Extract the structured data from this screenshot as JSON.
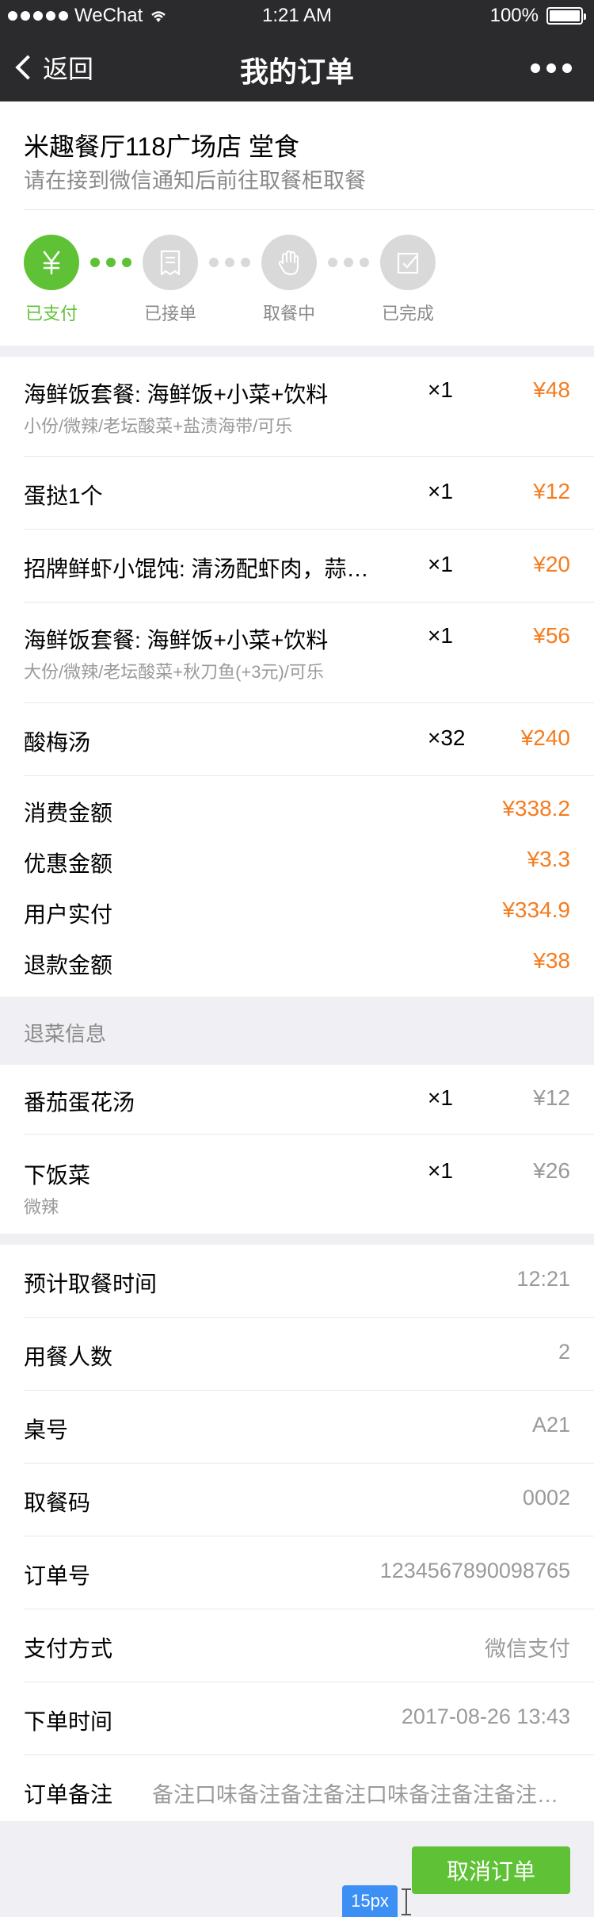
{
  "status_bar": {
    "carrier": "WeChat",
    "time": "1:21 AM",
    "battery": "100%"
  },
  "nav": {
    "back_label": "返回",
    "title": "我的订单"
  },
  "shop": {
    "name": "米趣餐厅118广场店 堂食",
    "tip": "请在接到微信通知后前往取餐柜取餐"
  },
  "steps": [
    {
      "label": "已支付",
      "icon": "yuan-icon",
      "active": true
    },
    {
      "label": "已接单",
      "icon": "receipt-icon",
      "active": false
    },
    {
      "label": "取餐中",
      "icon": "hand-icon",
      "active": false
    },
    {
      "label": "已完成",
      "icon": "check-square-icon",
      "active": false
    }
  ],
  "items": [
    {
      "name": "海鲜饭套餐: 海鲜饭+小菜+饮料",
      "spec": "小份/微辣/老坛酸菜+盐渍海带/可乐",
      "qty": "×1",
      "price": "¥48"
    },
    {
      "name": "蛋挞1个",
      "spec": "",
      "qty": "×1",
      "price": "¥12"
    },
    {
      "name": "招牌鲜虾小馄饨: 清汤配虾肉，蒜…",
      "spec": "",
      "qty": "×1",
      "price": "¥20"
    },
    {
      "name": "海鲜饭套餐: 海鲜饭+小菜+饮料",
      "spec": "大份/微辣/老坛酸菜+秋刀鱼(+3元)/可乐",
      "qty": "×1",
      "price": "¥56"
    },
    {
      "name": "酸梅汤",
      "spec": "",
      "qty": "×32",
      "price": "¥240"
    }
  ],
  "summary": [
    {
      "label": "消费金额",
      "value": "¥338.2"
    },
    {
      "label": "优惠金额",
      "value": "¥3.3"
    },
    {
      "label": "用户实付",
      "value": "¥334.9"
    },
    {
      "label": "退款金额",
      "value": "¥38"
    }
  ],
  "refund": {
    "title": "退菜信息",
    "items": [
      {
        "name": "番茄蛋花汤",
        "spec": "",
        "qty": "×1",
        "price": "¥12"
      },
      {
        "name": "下饭菜",
        "spec": "微辣",
        "qty": "×1",
        "price": "¥26"
      }
    ]
  },
  "info": [
    {
      "label": "预计取餐时间",
      "value": "12:21"
    },
    {
      "label": "用餐人数",
      "value": "2"
    },
    {
      "label": "桌号",
      "value": "A21"
    },
    {
      "label": "取餐码",
      "value": "0002"
    },
    {
      "label": "订单号",
      "value": "1234567890098765"
    },
    {
      "label": "支付方式",
      "value": "微信支付"
    },
    {
      "label": "下单时间",
      "value": "2017-08-26 13:43"
    },
    {
      "label": "订单备注",
      "value": "备注口味备注备注备注口味备注备注备注…"
    }
  ],
  "actions": {
    "cancel_label": "取消订单"
  },
  "annotation": {
    "badge": "15px"
  },
  "colors": {
    "green": "#5fc236",
    "orange": "#f57c1f",
    "nav_bg": "#2b2b2d"
  }
}
